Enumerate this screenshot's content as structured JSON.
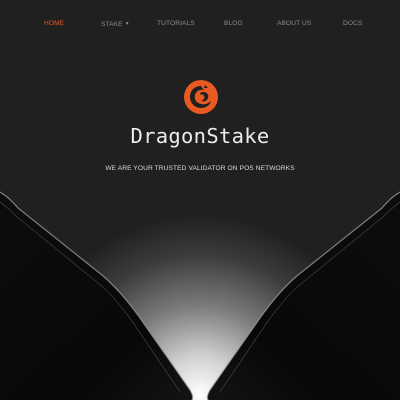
{
  "nav": {
    "items": [
      {
        "label": "HOME",
        "active": true
      },
      {
        "label": "STAKE",
        "active": false,
        "has_dropdown": true
      },
      {
        "label": "TUTORIALS",
        "active": false
      },
      {
        "label": "BLOG",
        "active": false
      },
      {
        "label": "ABOUT US",
        "active": false
      },
      {
        "label": "DOCS",
        "active": false
      }
    ],
    "dropdown_icon": "chevron-down-icon"
  },
  "hero": {
    "logo_icon": "dragon-icon",
    "brand": "DragonStake",
    "tagline": "WE ARE YOUR TRUSTED VALIDATOR ON POS NETWORKS"
  },
  "colors": {
    "accent": "#e85a22",
    "background": "#202020",
    "nav_text": "#8c8c8c",
    "brand_text": "#ececec"
  }
}
